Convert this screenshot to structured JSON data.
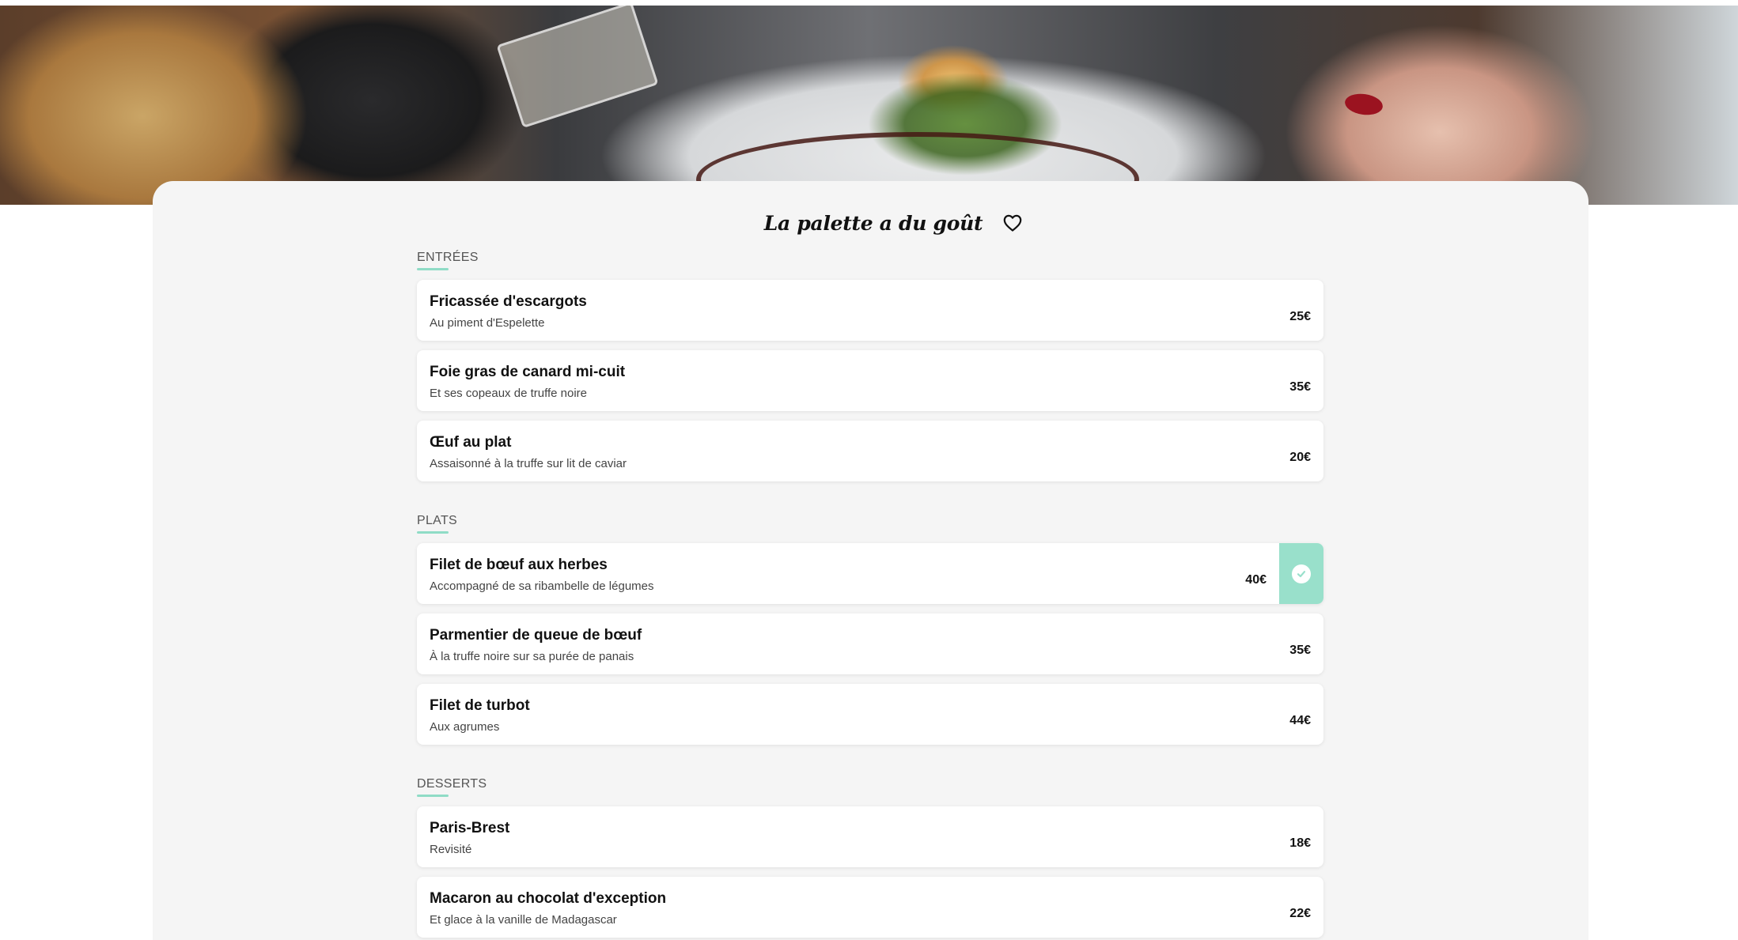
{
  "restaurant": {
    "name": "La palette a du goût"
  },
  "sections": [
    {
      "label": "ENTRÉES",
      "items": [
        {
          "name": "Fricassée d'escargots",
          "description": "Au piment d'Espelette",
          "price": "25€"
        },
        {
          "name": "Foie gras de canard mi-cuit",
          "description": "Et ses copeaux de truffe noire",
          "price": "35€"
        },
        {
          "name": "Œuf au plat",
          "description": "Assaisonné à la truffe sur lit de caviar",
          "price": "20€"
        }
      ]
    },
    {
      "label": "PLATS",
      "items": [
        {
          "name": "Filet de bœuf aux herbes",
          "description": "Accompagné de sa ribambelle de légumes",
          "price": "40€",
          "selected": true
        },
        {
          "name": "Parmentier de queue de bœuf",
          "description": "À la truffe noire sur sa purée de panais",
          "price": "35€"
        },
        {
          "name": "Filet de turbot",
          "description": "Aux agrumes",
          "price": "44€"
        }
      ]
    },
    {
      "label": "DESSERTS",
      "items": [
        {
          "name": "Paris-Brest",
          "description": "Revisité",
          "price": "18€"
        },
        {
          "name": "Macaron au chocolat d'exception",
          "description": "Et glace à la vanille de Madagascar",
          "price": "22€"
        }
      ]
    }
  ],
  "icons": {
    "favorite": "heart-icon",
    "selected": "check-icon"
  },
  "colors": {
    "accent": "#99e0cb",
    "underline": "#8fdcc6",
    "panel_background": "#f5f5f5",
    "card_background": "#ffffff"
  }
}
